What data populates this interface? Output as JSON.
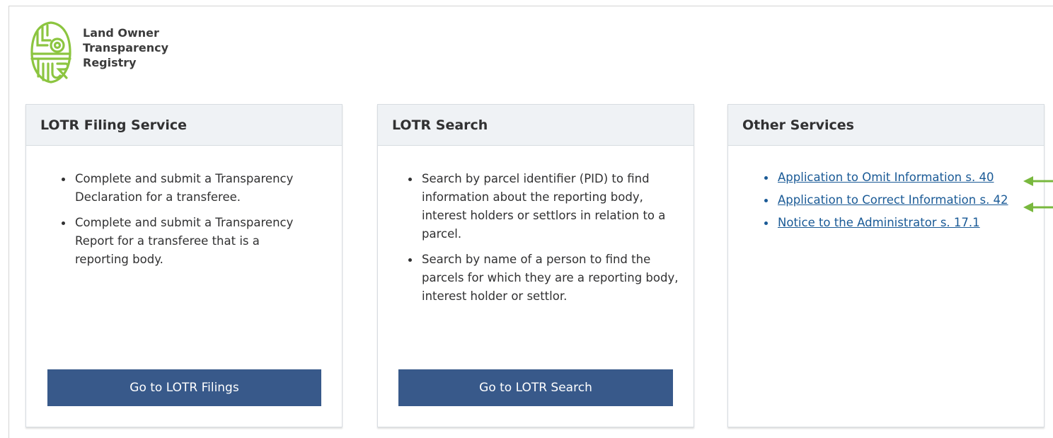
{
  "logo": {
    "icon": "ltr-leaf-logo",
    "lines": [
      "Land Owner",
      "Transparency",
      "Registry"
    ],
    "color": "#8cc540"
  },
  "cards": [
    {
      "title": "LOTR Filing Service",
      "items": [
        "Complete and submit a Transparency Declaration for a transferee.",
        "Complete and submit a Transparency Report for a transferee that is a reporting body."
      ],
      "button_label": "Go to LOTR Filings"
    },
    {
      "title": "LOTR Search",
      "items": [
        "Search by parcel identifier (PID) to find information about the reporting body, interest holders or settlors in relation to a parcel.",
        "Search by name of a person to find the parcels for which they are a reporting body, interest holder or settlor."
      ],
      "button_label": "Go to LOTR Search"
    },
    {
      "title": "Other Services",
      "links": [
        "Application to Omit Information s. 40",
        "Application to Correct Information s. 42",
        "Notice to the Administrator s. 17.1"
      ]
    }
  ],
  "annotations": {
    "arrow_color": "#79b83e",
    "arrow_icon": "arrow-left-icon"
  },
  "colors": {
    "button": "#38598a",
    "link": "#1a5a96",
    "header_bg": "#eff2f5"
  }
}
